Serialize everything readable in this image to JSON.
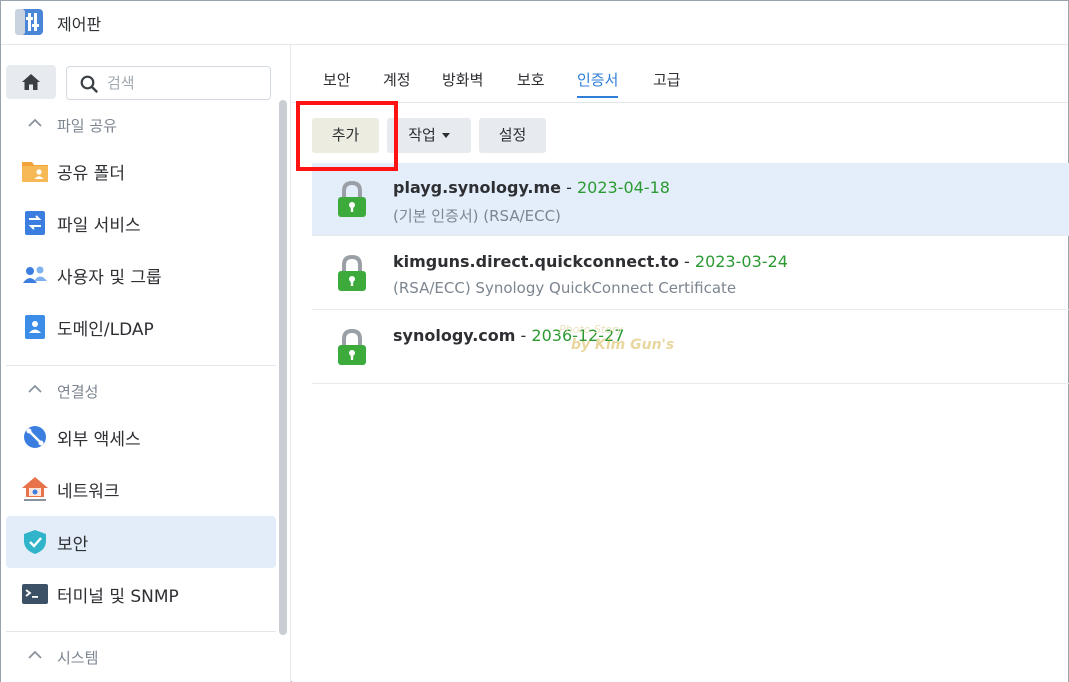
{
  "window": {
    "title": "제어판"
  },
  "sidebar": {
    "search_placeholder": "검색",
    "sections": [
      {
        "label": "파일 공유",
        "items": [
          {
            "label": "공유 폴더",
            "icon": "shared-folder-icon"
          },
          {
            "label": "파일 서비스",
            "icon": "file-services-icon"
          },
          {
            "label": "사용자 및 그룹",
            "icon": "user-group-icon"
          },
          {
            "label": "도메인/LDAP",
            "icon": "domain-ldap-icon"
          }
        ]
      },
      {
        "label": "연결성",
        "items": [
          {
            "label": "외부 액세스",
            "icon": "external-access-icon"
          },
          {
            "label": "네트워크",
            "icon": "network-icon"
          },
          {
            "label": "보안",
            "icon": "security-shield-icon",
            "active": true
          },
          {
            "label": "터미널 및 SNMP",
            "icon": "terminal-icon"
          }
        ]
      },
      {
        "label": "시스템",
        "items": []
      }
    ]
  },
  "main": {
    "tabs": [
      "보안",
      "계정",
      "방화벽",
      "보호",
      "인증서",
      "고급"
    ],
    "active_tab": "인증서",
    "toolbar": {
      "add": "추가",
      "action": "작업",
      "settings": "설정"
    },
    "certificates": [
      {
        "name": "playg.synology.me",
        "sep": " - ",
        "date": "2023-04-18",
        "desc": "(기본 인증서) (RSA/ECC)",
        "selected": true
      },
      {
        "name": "kimguns.direct.quickconnect.to",
        "sep": " - ",
        "date": "2023-03-24",
        "desc": "(RSA/ECC) Synology QuickConnect Certificate"
      },
      {
        "name": "synology.com",
        "sep": " - ",
        "date": "2036-12-27",
        "desc": ""
      }
    ]
  },
  "watermark": {
    "line1": "Photo Story",
    "line2": "by Kim Gun's"
  },
  "colors": {
    "accent": "#2f7ed8",
    "date_green": "#2b9a32",
    "lock_green": "#3cab3c",
    "highlight_red": "#ff1212",
    "selected_row": "#e4eefa"
  }
}
